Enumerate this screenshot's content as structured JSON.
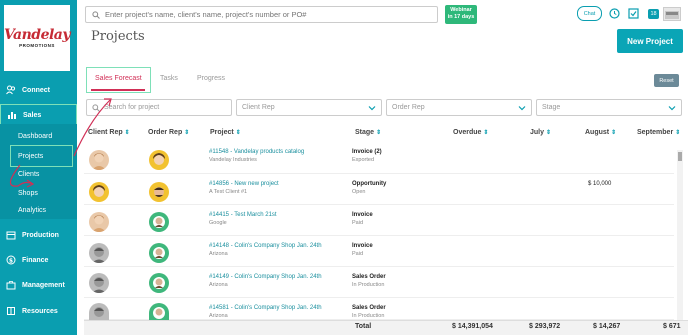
{
  "logo": {
    "main": "Vandelay",
    "sub": "PROMOTIONS"
  },
  "sidebar": {
    "items": [
      {
        "label": "Connect"
      },
      {
        "label": "Sales"
      },
      {
        "label": "Production"
      },
      {
        "label": "Finance"
      },
      {
        "label": "Management"
      },
      {
        "label": "Resources"
      }
    ],
    "sales_sub": [
      {
        "label": "Dashboard"
      },
      {
        "label": "Projects"
      },
      {
        "label": "Clients"
      },
      {
        "label": "Shops"
      },
      {
        "label": "Analytics"
      }
    ]
  },
  "topbar": {
    "search_placeholder": "Enter project's name, client's name, project's number or PO#",
    "webinar_line1": "Webinar",
    "webinar_line2": "in 17 days",
    "chat_label": "Chat",
    "badge_count": "18"
  },
  "header": {
    "title": "Projects",
    "new_project_label": "New Project"
  },
  "tabs": [
    {
      "label": "Sales Forecast"
    },
    {
      "label": "Tasks"
    },
    {
      "label": "Progress"
    }
  ],
  "reset_label": "Reset",
  "filters": {
    "search_placeholder": "Search for project",
    "client_rep": "Client Rep",
    "order_rep": "Order Rep",
    "stage": "Stage"
  },
  "table": {
    "columns": [
      "Client Rep",
      "Order Rep",
      "Project",
      "Stage",
      "Overdue",
      "July",
      "August",
      "September"
    ],
    "rows": [
      {
        "project": "#11548 - Vandelay products catalog",
        "client": "Vandelay Industries",
        "stage": "Invoice (2)",
        "stage_sub": "Exported",
        "august": ""
      },
      {
        "project": "#14856 - New new project",
        "client": "A Test Client #1",
        "stage": "Opportunity",
        "stage_sub": "Open",
        "august": "$ 10,000"
      },
      {
        "project": "#14415 - Test March 21st",
        "client": "Google",
        "stage": "Invoice",
        "stage_sub": "Paid",
        "august": ""
      },
      {
        "project": "#14148 - Colin's Company Shop Jan. 24th",
        "client": "Arizona",
        "stage": "Invoice",
        "stage_sub": "Paid",
        "august": ""
      },
      {
        "project": "#14149 - Colin's Company Shop Jan. 24th",
        "client": "Arizona",
        "stage": "Sales Order",
        "stage_sub": "In Production",
        "august": ""
      },
      {
        "project": "#14581 - Colin's Company Shop Jan. 24th",
        "client": "Arizona",
        "stage": "Sales Order",
        "stage_sub": "In Production",
        "august": ""
      }
    ],
    "totals": {
      "label": "Total",
      "overdue": "$ 14,391,054",
      "july": "$ 293,972",
      "august": "$ 14,267",
      "september": "$ 671"
    }
  },
  "colors": {
    "teal": "#0a9eb0",
    "accent_pink": "#d12f56",
    "highlight_green": "#7ee0b8",
    "webinar_green": "#2eb87a"
  }
}
